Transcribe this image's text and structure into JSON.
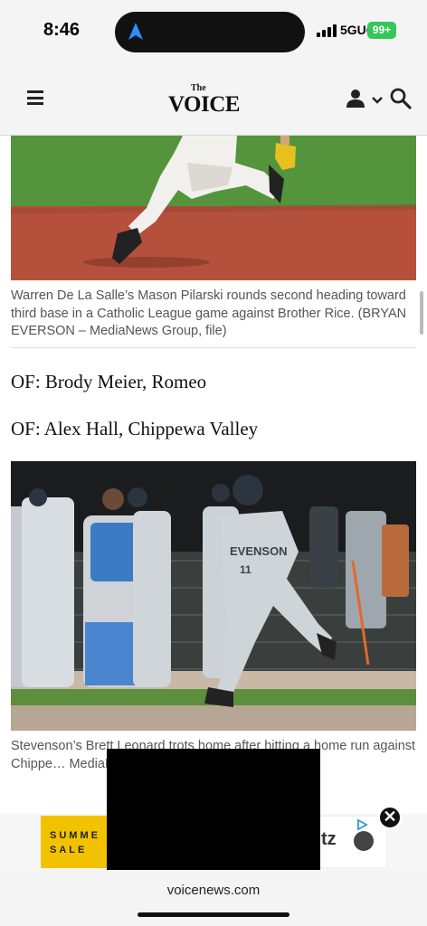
{
  "status_bar": {
    "time": "8:46",
    "network": "5GUC",
    "battery": "99+"
  },
  "header": {
    "logo_small": "The",
    "logo_main": "VOICE",
    "icons": [
      "menu-icon",
      "user-icon",
      "chevron-down-icon",
      "search-icon"
    ]
  },
  "article": {
    "caption_1": "Warren De La Salle’s Mason Pilarski rounds second heading toward third base in a Catholic League game against Brother Rice. (BRYAN EVERSON – MediaNews Group, file)",
    "of_line_1": "OF: Brody Meier, Romeo",
    "of_line_2": "OF: Alex Hall, Chippewa Valley",
    "caption_2": "Stevenson’s Brett Leonard trots home after hitting a home run against Chippe… MediaNews Group, file)"
  },
  "ad": {
    "left_text_1": "SUMME",
    "left_text_2": "SALE",
    "right_text": "tz",
    "close_label": "✕"
  },
  "browser": {
    "url": "voicenews.com"
  },
  "colors": {
    "field_grass": "#4f8f3a",
    "infield_dirt": "#b5503c",
    "battery_green": "#34c759",
    "ad_yellow": "#f2c200"
  }
}
